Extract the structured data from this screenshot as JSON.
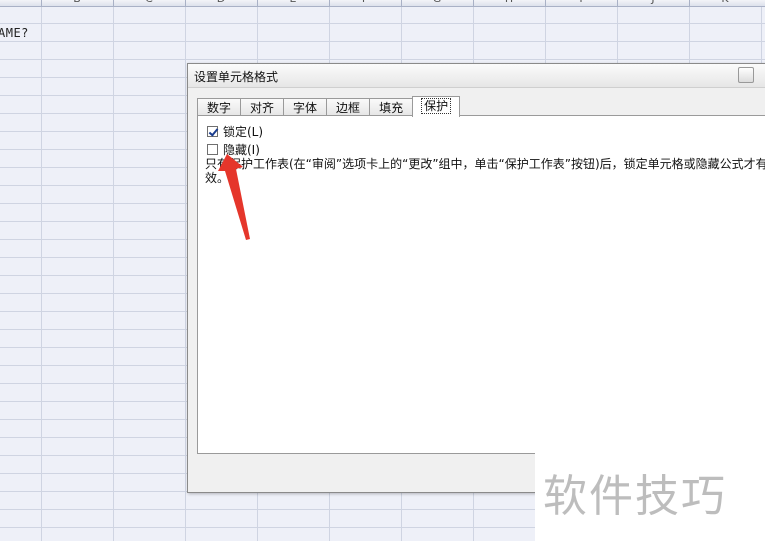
{
  "sheet": {
    "columns": [
      "B",
      "C",
      "D",
      "E",
      "F",
      "G",
      "H",
      "I",
      "J",
      "K"
    ],
    "cell_text": "AME?"
  },
  "dialog": {
    "title": "设置单元格格式",
    "tabs": [
      {
        "label": "数字",
        "active": false
      },
      {
        "label": "对齐",
        "active": false
      },
      {
        "label": "字体",
        "active": false
      },
      {
        "label": "边框",
        "active": false
      },
      {
        "label": "填充",
        "active": false
      },
      {
        "label": "保护",
        "active": true
      }
    ],
    "locked_label": "锁定(L)",
    "locked_checked": true,
    "hidden_label": "隐藏(I)",
    "hidden_checked": false,
    "description": "只有保护工作表(在“审阅”选项卡上的“更改”组中，单击“保护工作表”按钮)后，锁定单元格或隐藏公式才有效。"
  },
  "watermark": "软件技巧",
  "annotation": {
    "color": "#e5362b",
    "icon": "red-arrow-pointer"
  }
}
